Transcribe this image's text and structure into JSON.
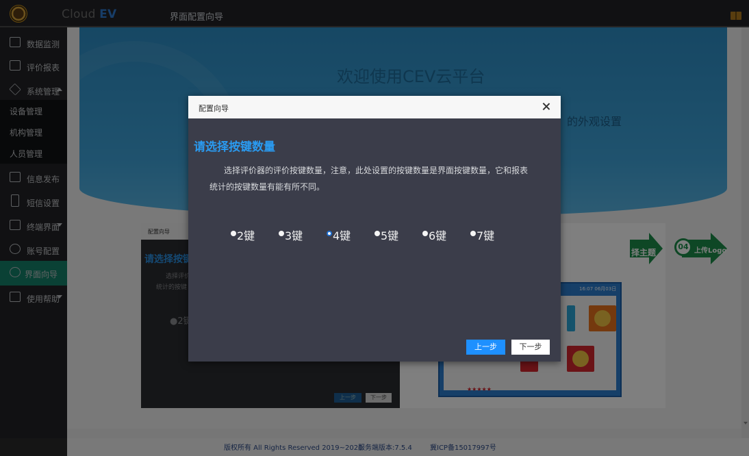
{
  "header": {
    "brand_prefix": "Cloud",
    "brand_suffix": "EV",
    "page_title": "界面配置向导"
  },
  "sidebar": {
    "items": [
      {
        "label": "数据监测",
        "icon": "monitor-icon"
      },
      {
        "label": "评价报表",
        "icon": "report-icon"
      },
      {
        "label": "系统管理",
        "icon": "diamond-icon"
      },
      {
        "label": "设备管理"
      },
      {
        "label": "机构管理"
      },
      {
        "label": "人员管理"
      },
      {
        "label": "信息发布",
        "icon": "image-icon"
      },
      {
        "label": "短信设置",
        "icon": "phone-icon"
      },
      {
        "label": "终端界面",
        "icon": "window-icon"
      },
      {
        "label": "账号配置",
        "icon": "gear-icon"
      },
      {
        "label": "界面向导",
        "icon": "check-circle-icon"
      },
      {
        "label": "使用帮助",
        "icon": "help-icon"
      }
    ]
  },
  "background": {
    "hero_title": "欢迎使用CEV云平台",
    "hero_sub_partial": "的外观设置",
    "mini_dialog_title": "配置向导",
    "mini_heading": "请选择按键",
    "mini_p1": "选择评价",
    "mini_p2": "统计的按键",
    "mini_option": "●2键",
    "mini_prev": "上一步",
    "mini_next": "下一步",
    "step3_label": "择主题",
    "step4_num": "04",
    "step4_label": "上传Logo",
    "preview_clock": "16:07 06月03日",
    "stars": "★★★★★"
  },
  "dialog": {
    "title": "配置向导",
    "heading": "请选择按键数量",
    "paragraph_line1": "选择评价器的评价按键数量，注意，此处设置的按键数量是界面按键数量，它和报表",
    "paragraph_line2": "统计的按键数量有能有所不同。",
    "options": [
      "2键",
      "3键",
      "4键",
      "5键",
      "6键",
      "7键"
    ],
    "selected_option": "4键",
    "prev_button": "上一步",
    "next_button": "下一步"
  },
  "footer": {
    "copyright": "版权所有 All Rights Reserved 2019~2020",
    "version": "服务端版本:7.5.4",
    "icp": "冀ICP备15017997号"
  }
}
